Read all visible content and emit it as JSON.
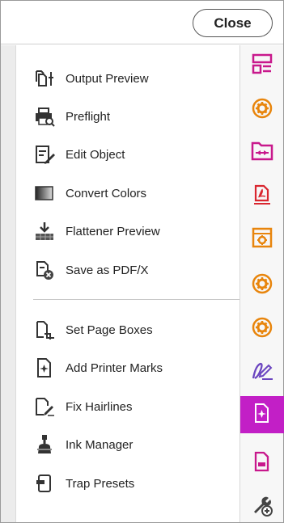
{
  "header": {
    "close_label": "Close"
  },
  "tools_group_1": [
    {
      "label": "Output Preview",
      "icon": "output-preview-icon"
    },
    {
      "label": "Preflight",
      "icon": "preflight-icon"
    },
    {
      "label": "Edit Object",
      "icon": "edit-object-icon"
    },
    {
      "label": "Convert Colors",
      "icon": "convert-colors-icon"
    },
    {
      "label": "Flattener Preview",
      "icon": "flattener-preview-icon"
    },
    {
      "label": "Save as PDF/X",
      "icon": "save-as-pdfx-icon"
    }
  ],
  "tools_group_2": [
    {
      "label": "Set Page Boxes",
      "icon": "set-page-boxes-icon"
    },
    {
      "label": "Add Printer Marks",
      "icon": "add-printer-marks-icon"
    },
    {
      "label": "Fix Hairlines",
      "icon": "fix-hairlines-icon"
    },
    {
      "label": "Ink Manager",
      "icon": "ink-manager-icon"
    },
    {
      "label": "Trap Presets",
      "icon": "trap-presets-icon"
    }
  ],
  "rightbar": {
    "icons": [
      "organize-pages-icon",
      "gear-badge-icon",
      "combine-files-icon",
      "export-pdf-icon",
      "action-wizard-icon",
      "gear-badge-icon",
      "gear-badge-icon",
      "fill-sign-icon",
      "print-production-icon",
      "form-icon",
      "customize-tools-icon"
    ],
    "active_index": 8
  },
  "colors": {
    "accent": "#c21fc6",
    "orange": "#e8850c",
    "red": "#d9262f",
    "pink": "#c8188c",
    "purple": "#6b45c0"
  }
}
